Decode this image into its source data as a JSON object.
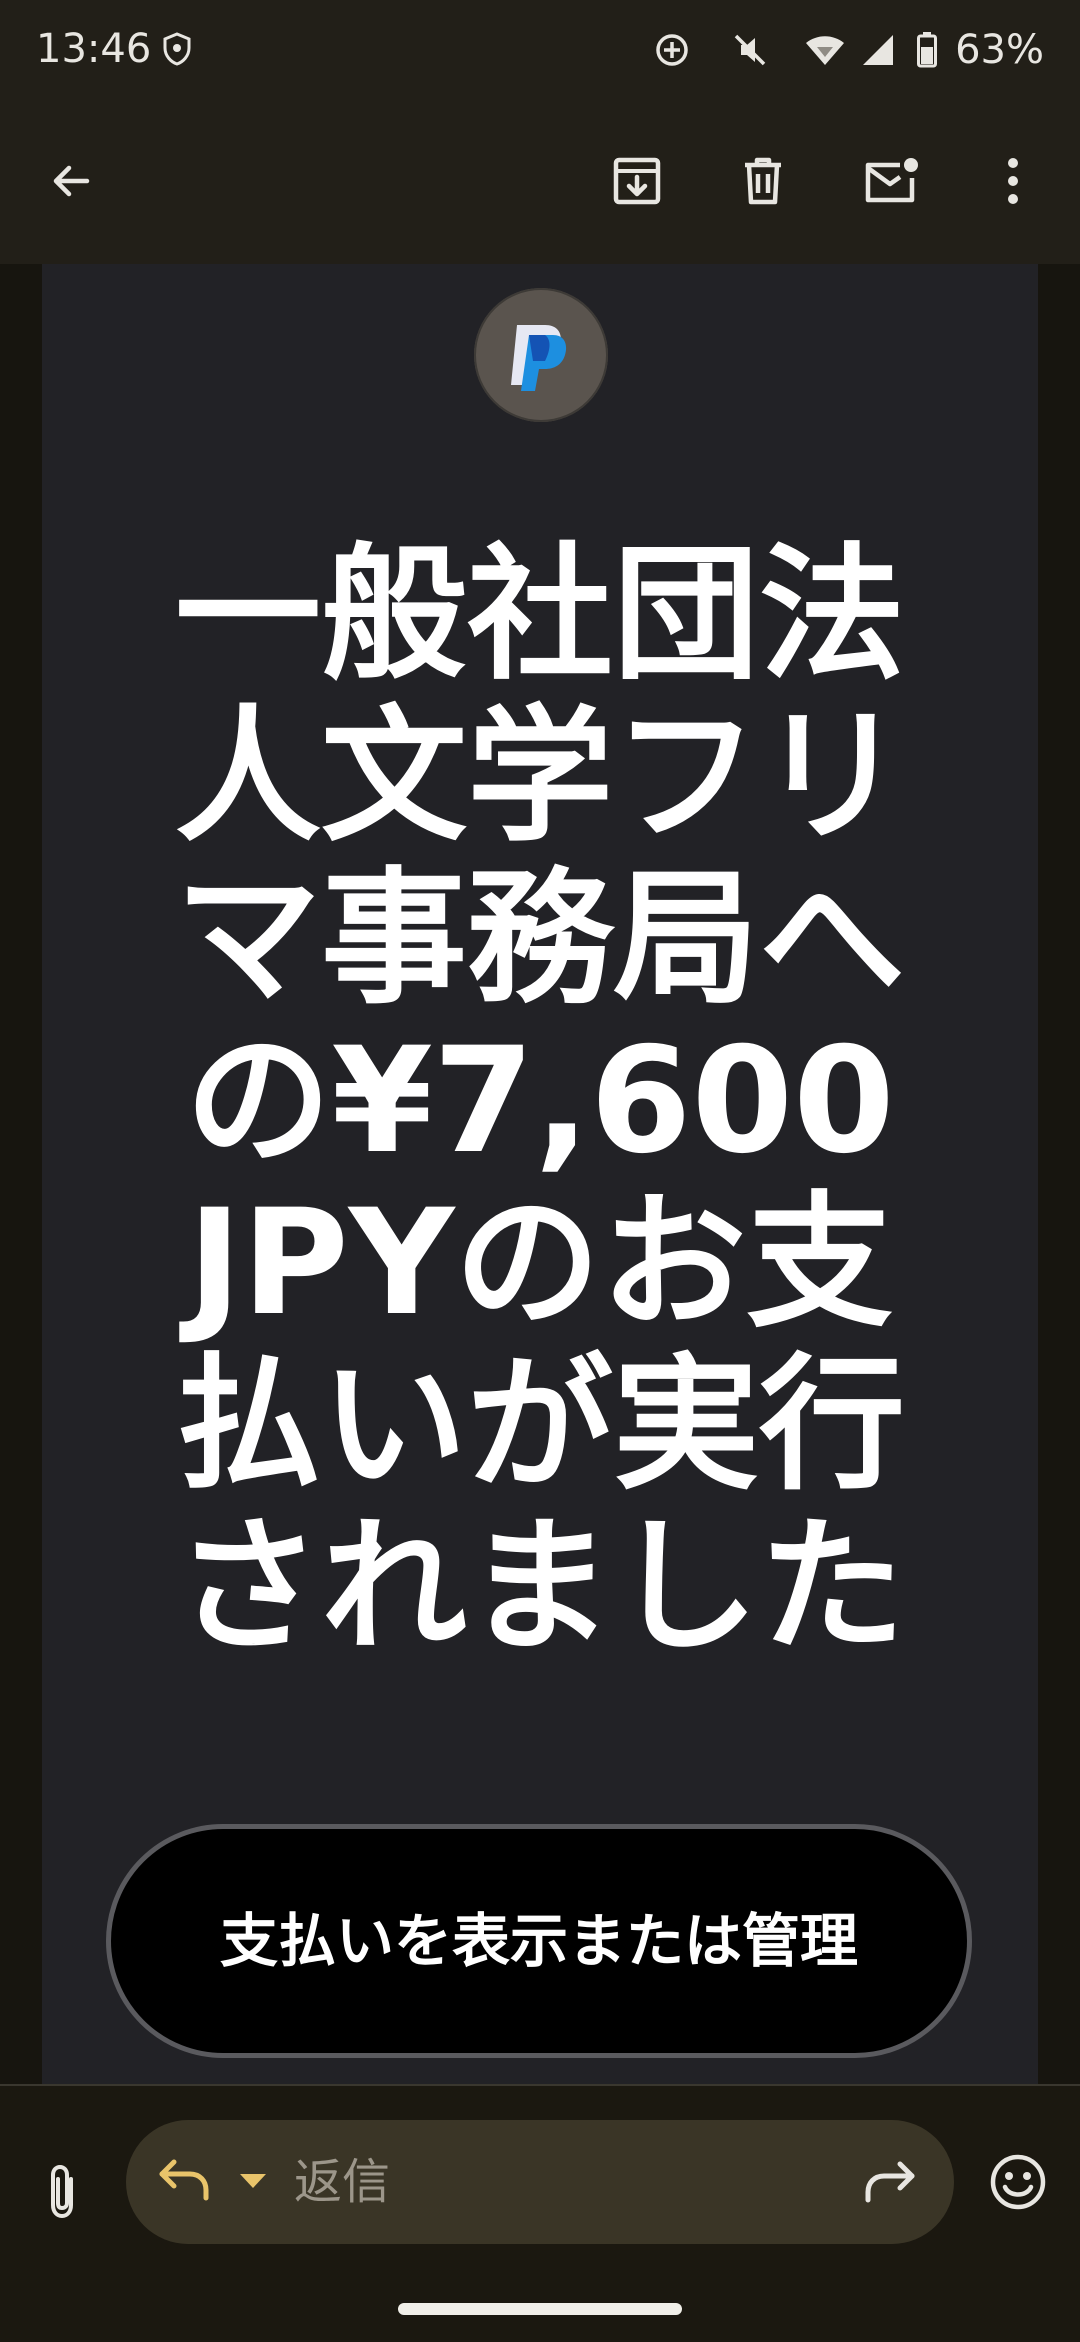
{
  "status_bar": {
    "time": "13:46",
    "battery": "63%",
    "icons": [
      "shield-icon",
      "data-saver-icon",
      "vibrate-off-icon",
      "wifi-icon",
      "cell-signal-icon",
      "battery-icon"
    ]
  },
  "app_bar": {
    "icons": [
      "back-arrow-icon",
      "archive-icon",
      "delete-icon",
      "mark-unread-icon",
      "more-vert-icon"
    ]
  },
  "email": {
    "logo": "paypal-logo",
    "headline": "一般社団法人文学フリマ事務局への¥7,600 JPYのお支払いが実行されました",
    "cta_label": "支払いを表示または管理"
  },
  "reply_bar": {
    "placeholder": "返信",
    "icons": [
      "attachment-icon",
      "reply-icon",
      "caret-down-icon",
      "forward-icon",
      "emoji-icon"
    ]
  },
  "colors": {
    "bar_background": "#221f18",
    "card_background": "#222226",
    "reply_pill": "#3a3526",
    "accent": "#e9c46a"
  }
}
